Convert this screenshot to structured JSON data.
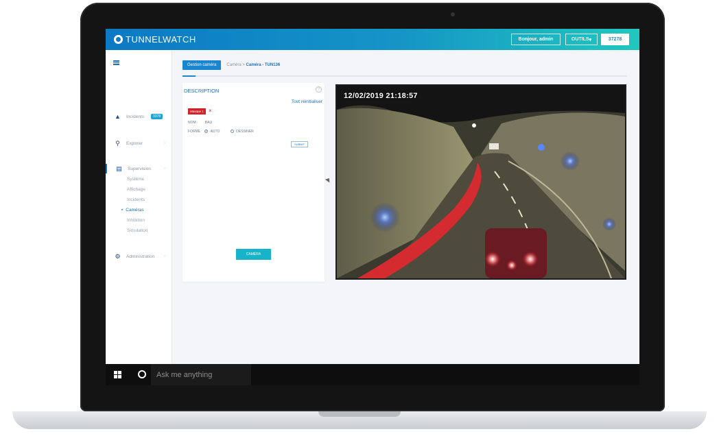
{
  "header": {
    "brand": "TUNNELWATCH",
    "greeting": "Bonjour, admin",
    "tools": "OUTILS",
    "code": "37278"
  },
  "sidebar": {
    "incidents": {
      "label": "Incidents",
      "badge": "3378"
    },
    "explorer": {
      "label": "Explorer"
    },
    "supervision": {
      "label": "Supervision",
      "items": [
        "Système",
        "Affichage",
        "Incidents",
        "Caméras",
        "Inhibition",
        "Simulation"
      ],
      "active_index": 3
    },
    "administration": {
      "label": "Administration"
    }
  },
  "tabs": {
    "active": "Gestion caméra",
    "crumb_prefix": "Caméra >",
    "crumb_current": "Caméra - TUN136"
  },
  "progress": {
    "fraction": 0.03
  },
  "description": {
    "title": "DESCRIPTION",
    "help": "?",
    "reset": "Tout réinitialiser",
    "tag": "Masque 1",
    "tag_close": "×",
    "nom_label": "NOM :",
    "nom_value": "BAU",
    "forme_label": "FORME",
    "opt_auto": "AUTO",
    "opt_draw": "DESSINER",
    "submit": "SUBMIT",
    "camera_button": "CAMÉRA"
  },
  "video": {
    "timestamp": "12/02/2019 21:18:57"
  },
  "taskbar": {
    "search_placeholder": "Ask me anything"
  },
  "colors": {
    "accent": "#1a86d0",
    "header_end": "#21c8be",
    "tag": "#d1232a",
    "road_stripe": "#d42b30"
  }
}
